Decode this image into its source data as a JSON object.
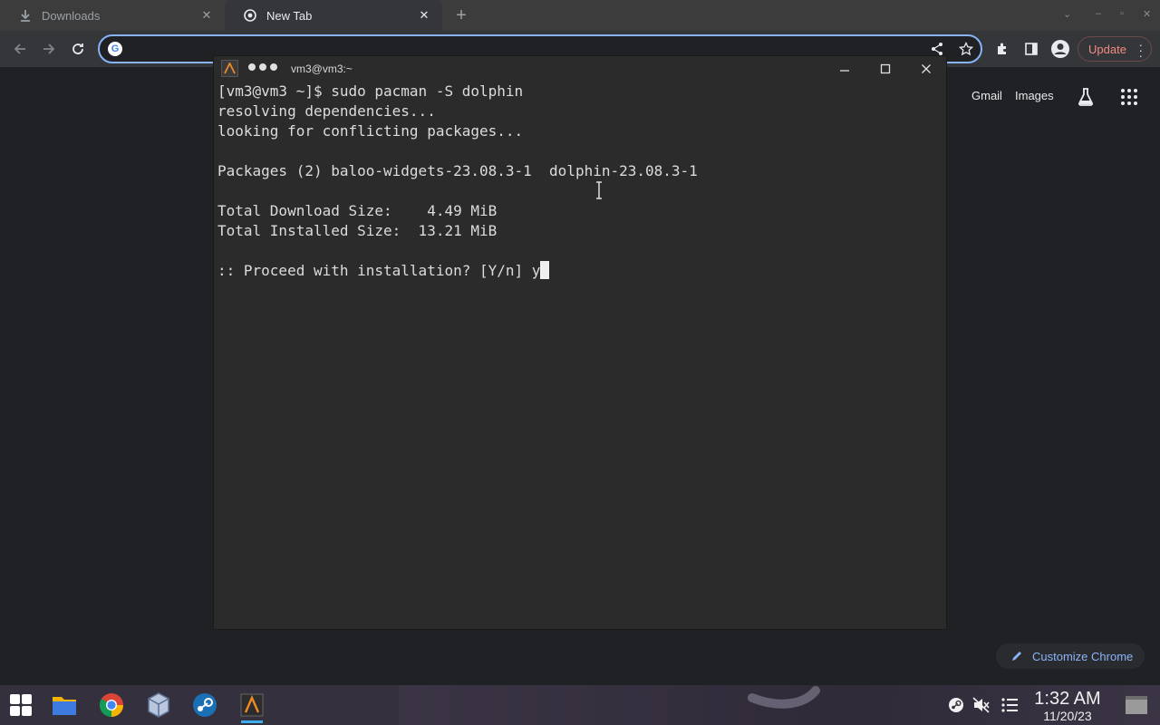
{
  "browser": {
    "tabs": [
      {
        "label": "Downloads",
        "icon": "download-icon",
        "active": false
      },
      {
        "label": "New Tab",
        "icon": "chrome-icon",
        "active": true
      }
    ],
    "omnibox": {
      "value": "",
      "placeholder": ""
    },
    "update_label": "Update",
    "ntp_links": {
      "gmail": "Gmail",
      "images": "Images"
    },
    "customize_label": "Customize Chrome"
  },
  "terminal": {
    "title": "vm3@vm3:~",
    "lines": [
      "[vm3@vm3 ~]$ sudo pacman -S dolphin",
      "resolving dependencies...",
      "looking for conflicting packages...",
      "",
      "Packages (2) baloo-widgets-23.08.3-1  dolphin-23.08.3-1",
      "",
      "Total Download Size:    4.49 MiB",
      "Total Installed Size:  13.21 MiB",
      "",
      ":: Proceed with installation? [Y/n] y"
    ]
  },
  "taskbar": {
    "apps": [
      "start-menu-icon",
      "file-manager-icon",
      "chrome-icon",
      "virtualbox-icon",
      "steam-icon",
      "terminal-icon"
    ],
    "tray": [
      "steam-tray-icon",
      "speaker-muted-icon",
      "task-list-icon"
    ],
    "time": "1:32 AM",
    "date": "11/20/23"
  },
  "colors": {
    "accent": "#8ab4f8",
    "update": "#f28b82",
    "taskbar": "#34303d",
    "terminal_bg": "#2b2b2b"
  }
}
